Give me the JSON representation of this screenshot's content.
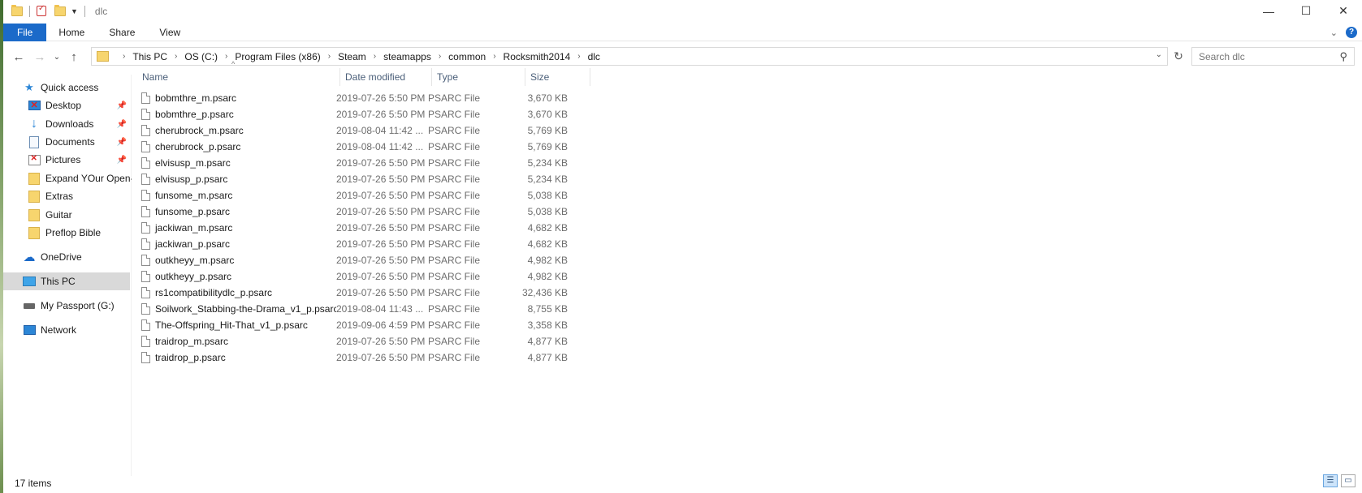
{
  "window": {
    "title": "dlc",
    "minimize_glyph": "—",
    "maximize_glyph": "☐",
    "close_glyph": "✕"
  },
  "ribbon": {
    "tabs": [
      "File",
      "Home",
      "Share",
      "View"
    ],
    "accent_color": "#1b6ac9",
    "help_label": "?"
  },
  "address_bar": {
    "breadcrumbs": [
      "This PC",
      "OS (C:)",
      "Program Files (x86)",
      "Steam",
      "steamapps",
      "common",
      "Rocksmith2014",
      "dlc"
    ]
  },
  "search": {
    "placeholder": "Search dlc"
  },
  "sidebar": {
    "items": [
      {
        "label": "Quick access",
        "icon": "star-icon",
        "pinned": false
      },
      {
        "label": "Desktop",
        "icon": "desktop-icon",
        "pinned": true
      },
      {
        "label": "Downloads",
        "icon": "download-icon",
        "pinned": true
      },
      {
        "label": "Documents",
        "icon": "documents-icon",
        "pinned": true
      },
      {
        "label": "Pictures",
        "icon": "pictures-icon",
        "pinned": true
      },
      {
        "label": "Expand YOur Open-",
        "icon": "folder-icon",
        "pinned": false
      },
      {
        "label": "Extras",
        "icon": "folder-icon",
        "pinned": false
      },
      {
        "label": "Guitar",
        "icon": "folder-icon",
        "pinned": false
      },
      {
        "label": "Preflop Bible",
        "icon": "folder-icon",
        "pinned": false
      },
      {
        "label": "OneDrive",
        "icon": "cloud-icon",
        "pinned": false
      },
      {
        "label": "This PC",
        "icon": "computer-icon",
        "pinned": false,
        "selected": true
      },
      {
        "label": "My Passport (G:)",
        "icon": "drive-icon",
        "pinned": false
      },
      {
        "label": "Network",
        "icon": "network-icon",
        "pinned": false
      }
    ]
  },
  "columns": [
    "Name",
    "Date modified",
    "Type",
    "Size"
  ],
  "files": [
    {
      "name": "bobmthre_m.psarc",
      "date": "2019-07-26 5:50 PM",
      "type": "PSARC File",
      "size": "3,670 KB"
    },
    {
      "name": "bobmthre_p.psarc",
      "date": "2019-07-26 5:50 PM",
      "type": "PSARC File",
      "size": "3,670 KB"
    },
    {
      "name": "cherubrock_m.psarc",
      "date": "2019-08-04 11:42 ...",
      "type": "PSARC File",
      "size": "5,769 KB"
    },
    {
      "name": "cherubrock_p.psarc",
      "date": "2019-08-04 11:42 ...",
      "type": "PSARC File",
      "size": "5,769 KB"
    },
    {
      "name": "elvisusp_m.psarc",
      "date": "2019-07-26 5:50 PM",
      "type": "PSARC File",
      "size": "5,234 KB"
    },
    {
      "name": "elvisusp_p.psarc",
      "date": "2019-07-26 5:50 PM",
      "type": "PSARC File",
      "size": "5,234 KB"
    },
    {
      "name": "funsome_m.psarc",
      "date": "2019-07-26 5:50 PM",
      "type": "PSARC File",
      "size": "5,038 KB"
    },
    {
      "name": "funsome_p.psarc",
      "date": "2019-07-26 5:50 PM",
      "type": "PSARC File",
      "size": "5,038 KB"
    },
    {
      "name": "jackiwan_m.psarc",
      "date": "2019-07-26 5:50 PM",
      "type": "PSARC File",
      "size": "4,682 KB"
    },
    {
      "name": "jackiwan_p.psarc",
      "date": "2019-07-26 5:50 PM",
      "type": "PSARC File",
      "size": "4,682 KB"
    },
    {
      "name": "outkheyy_m.psarc",
      "date": "2019-07-26 5:50 PM",
      "type": "PSARC File",
      "size": "4,982 KB"
    },
    {
      "name": "outkheyy_p.psarc",
      "date": "2019-07-26 5:50 PM",
      "type": "PSARC File",
      "size": "4,982 KB"
    },
    {
      "name": "rs1compatibilitydlc_p.psarc",
      "date": "2019-07-26 5:50 PM",
      "type": "PSARC File",
      "size": "32,436 KB"
    },
    {
      "name": "Soilwork_Stabbing-the-Drama_v1_p.psarc",
      "date": "2019-08-04 11:43 ...",
      "type": "PSARC File",
      "size": "8,755 KB"
    },
    {
      "name": "The-Offspring_Hit-That_v1_p.psarc",
      "date": "2019-09-06 4:59 PM",
      "type": "PSARC File",
      "size": "3,358 KB"
    },
    {
      "name": "traidrop_m.psarc",
      "date": "2019-07-26 5:50 PM",
      "type": "PSARC File",
      "size": "4,877 KB"
    },
    {
      "name": "traidrop_p.psarc",
      "date": "2019-07-26 5:50 PM",
      "type": "PSARC File",
      "size": "4,877 KB"
    }
  ],
  "status": {
    "item_count": "17 items"
  }
}
